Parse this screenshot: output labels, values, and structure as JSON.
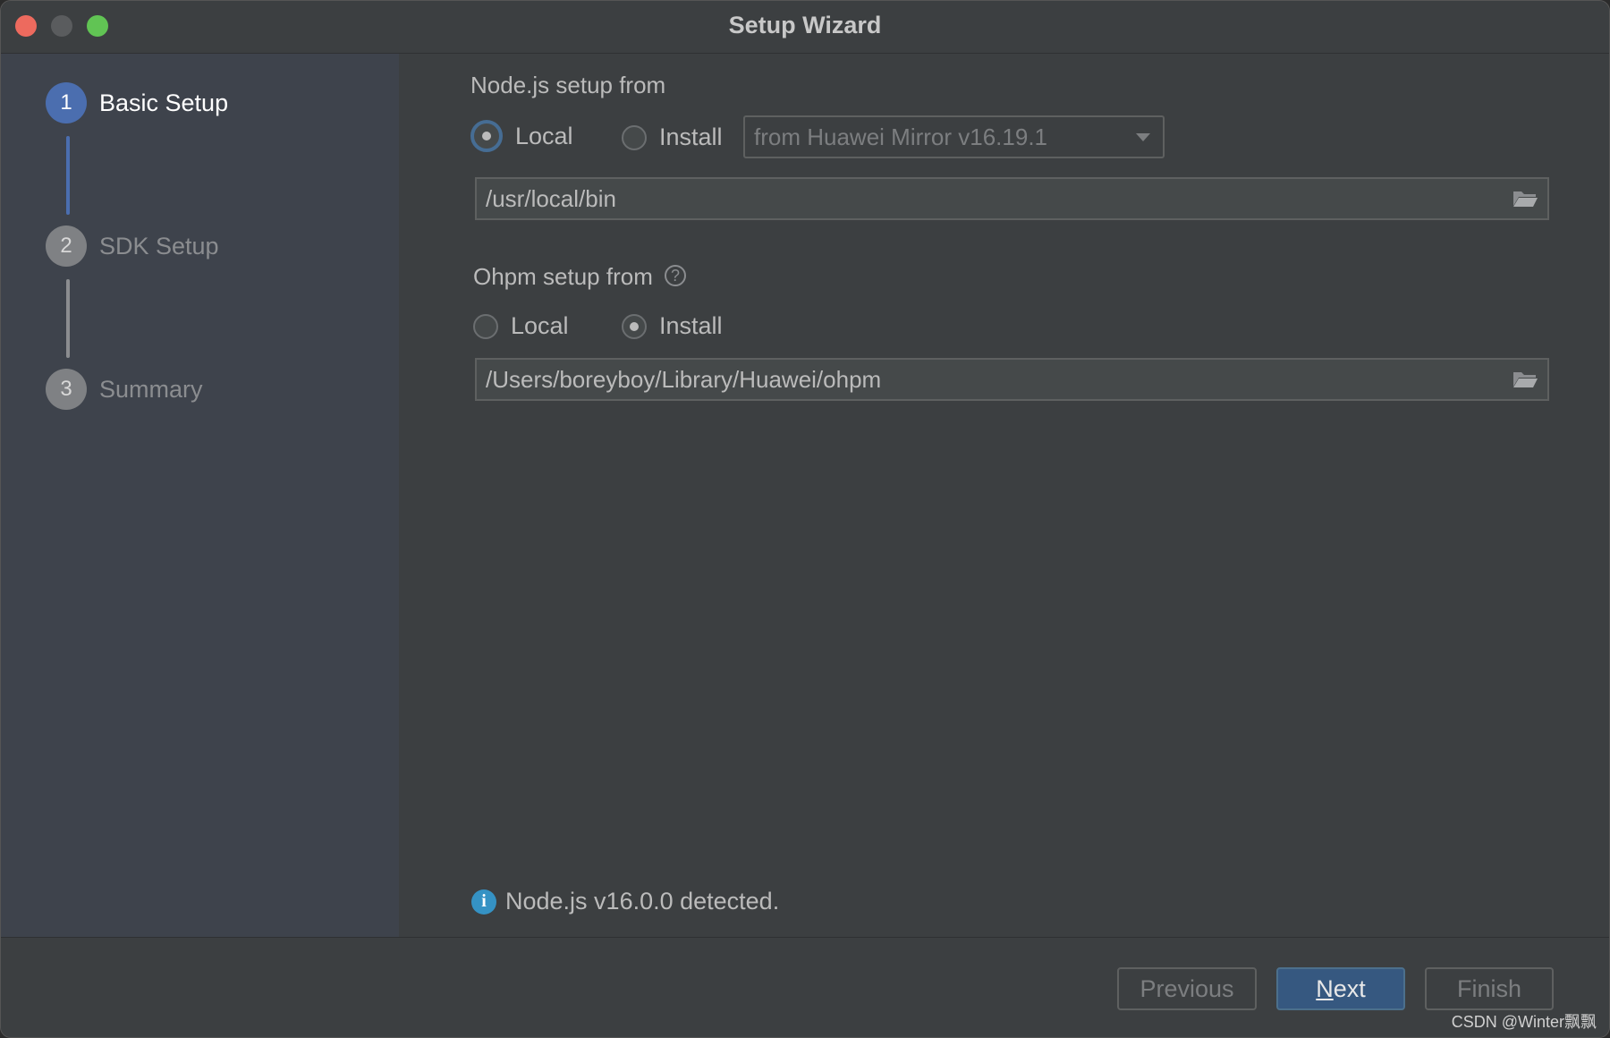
{
  "window": {
    "title": "Setup Wizard"
  },
  "sidebar": {
    "steps": [
      {
        "number": "1",
        "label": "Basic Setup",
        "state": "active"
      },
      {
        "number": "2",
        "label": "SDK Setup",
        "state": "inactive"
      },
      {
        "number": "3",
        "label": "Summary",
        "state": "inactive"
      }
    ]
  },
  "nodejs": {
    "section_label": "Node.js setup from",
    "local_label": "Local",
    "install_label": "Install",
    "selected": "Local",
    "mirror_value": "from Huawei Mirror v16.19.1",
    "path": "/usr/local/bin"
  },
  "ohpm": {
    "section_label": "Ohpm setup from",
    "help_glyph": "?",
    "local_label": "Local",
    "install_label": "Install",
    "selected": "Install",
    "path": "/Users/boreyboy/Library/Huawei/ohpm"
  },
  "status": {
    "info_glyph": "i",
    "message": "Node.js v16.0.0 detected."
  },
  "footer": {
    "previous_label": "Previous",
    "next_mnemonic": "N",
    "next_rest": "ext",
    "finish_label": "Finish"
  },
  "watermark": "CSDN @Winter飘飘",
  "colors": {
    "accent": "#4b6eaf",
    "primary_button": "#365880",
    "info": "#3592c4"
  }
}
